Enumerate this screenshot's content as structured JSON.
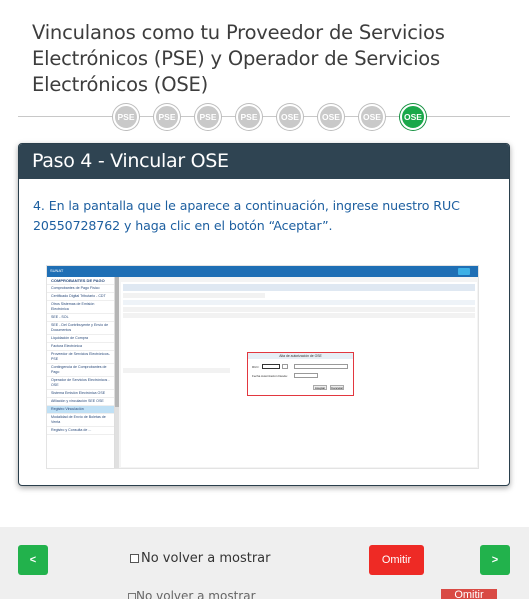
{
  "title": "Vinculanos como tu Proveedor de Servicios Electrónicos (PSE) y Operador de Servicios Electrónicos (OSE)",
  "steps": [
    {
      "label": "PSE",
      "active": false
    },
    {
      "label": "PSE",
      "active": false
    },
    {
      "label": "PSE",
      "active": false
    },
    {
      "label": "PSE",
      "active": false
    },
    {
      "label": "OSE",
      "active": false
    },
    {
      "label": "OSE",
      "active": false
    },
    {
      "label": "OSE",
      "active": false
    },
    {
      "label": "OSE",
      "active": true
    }
  ],
  "card": {
    "heading": "Paso 4 - Vincular OSE",
    "text": "4. En la pantalla que le aparece a continuación, ingrese nuestro RUC 20550728762 y haga clic en el botón “Aceptar”."
  },
  "embedded": {
    "brand": "SUNAT",
    "sidebar_items": [
      "COMPROBANTES DE PAGO",
      "Comprobantes de Pago Físico",
      "Certificado Digital Tributario - CDT",
      "Otros Sistemas de Emisión Electrónica",
      "SEE - SOL",
      "SEE - Del Contribuyente y Envío de Documentos",
      "Liquidación de Compra",
      "Factura Electrónica",
      "Proveedor de Servicios Electrónicos-PSE",
      "Contingencia de Comprobantes de Pago",
      "Operador de Servicios Electrónicos - OSE",
      "Sistema Emisión Electrónica OSE",
      "Afiliación y vinculación SEE OSE",
      "Registro Vinculación",
      "Modalidad de Envío de Boletas de Venta",
      "Registro y Consulta de ..."
    ],
    "dialog_title": "Alta de autorización de OSE"
  },
  "footer": {
    "prev_label": "<",
    "next_label": ">",
    "checkbox_label": "No volver a mostrar",
    "omit_label": "Omitir"
  },
  "colors": {
    "accent": "#22b24c",
    "header": "#2f4452",
    "omit": "#ee2a25",
    "link_text": "#1d5fa0"
  }
}
